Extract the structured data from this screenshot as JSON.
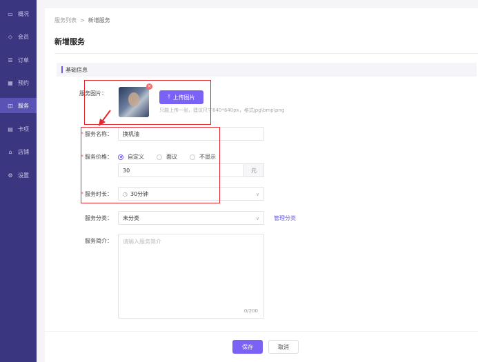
{
  "sidebar": {
    "items": [
      {
        "label": "概况",
        "icon": "monitor-icon",
        "glyph": "▭"
      },
      {
        "label": "会员",
        "icon": "diamond-icon",
        "glyph": "◇"
      },
      {
        "label": "订单",
        "icon": "list-icon",
        "glyph": "☰"
      },
      {
        "label": "预约",
        "icon": "calendar-icon",
        "glyph": "▦"
      },
      {
        "label": "服务",
        "icon": "service-icon",
        "glyph": "◫",
        "active": true
      },
      {
        "label": "卡项",
        "icon": "card-icon",
        "glyph": "▤"
      },
      {
        "label": "店铺",
        "icon": "store-icon",
        "glyph": "⌂"
      },
      {
        "label": "设置",
        "icon": "gear-icon",
        "glyph": "⚙"
      }
    ]
  },
  "breadcrumb": {
    "parent": "服务列表",
    "separator": ">",
    "current": "新增服务"
  },
  "page_title": "新增服务",
  "section_title": "基础信息",
  "form": {
    "image_label": "服务图片：",
    "upload_label": "上传图片",
    "upload_icon": "upload-icon",
    "upload_hint": "只能上传一张，建议尺寸640*640px，格式jpg\\bmp\\png",
    "name_label": "服务名称：",
    "name_value": "换机油",
    "price_label": "服务价格：",
    "price_options": [
      "自定义",
      "面议",
      "不显示"
    ],
    "price_selected": "自定义",
    "price_value": "30",
    "price_unit": "元",
    "duration_label": "服务时长：",
    "duration_value": "30分钟",
    "category_label": "服务分类：",
    "category_value": "未分类",
    "manage_category_label": "管理分类",
    "intro_label": "服务简介：",
    "intro_placeholder": "请输入服务简介",
    "intro_count": "0/200"
  },
  "footer": {
    "save_label": "保存",
    "cancel_label": "取消"
  },
  "colors": {
    "sidebar_bg": "#3b3680",
    "accent": "#7b61f5",
    "annotation": "#e5282f"
  }
}
